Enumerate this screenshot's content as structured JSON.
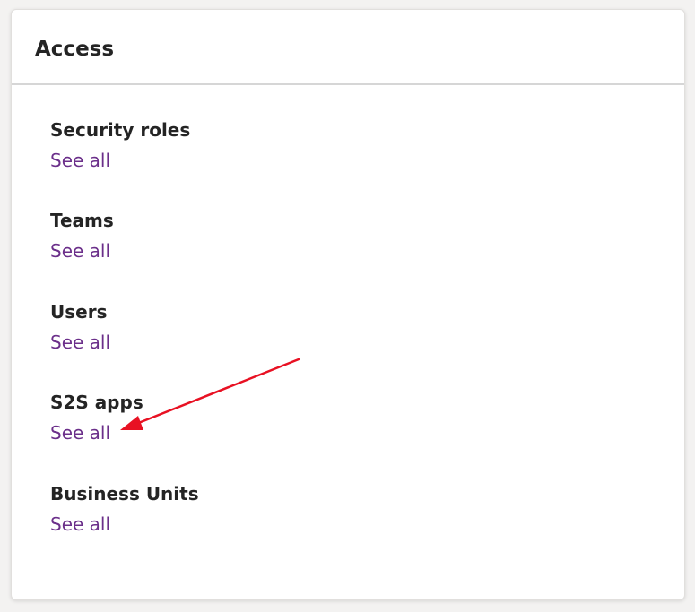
{
  "card": {
    "title": "Access",
    "sections": [
      {
        "title": "Security roles",
        "link": "See all"
      },
      {
        "title": "Teams",
        "link": "See all"
      },
      {
        "title": "Users",
        "link": "See all"
      },
      {
        "title": "S2S apps",
        "link": "See all"
      },
      {
        "title": "Business Units",
        "link": "See all"
      }
    ]
  },
  "colors": {
    "link": "#6b2f8a",
    "heading": "#242424",
    "annotation_arrow": "#e81123"
  },
  "annotation": {
    "icon": "arrow-icon"
  }
}
